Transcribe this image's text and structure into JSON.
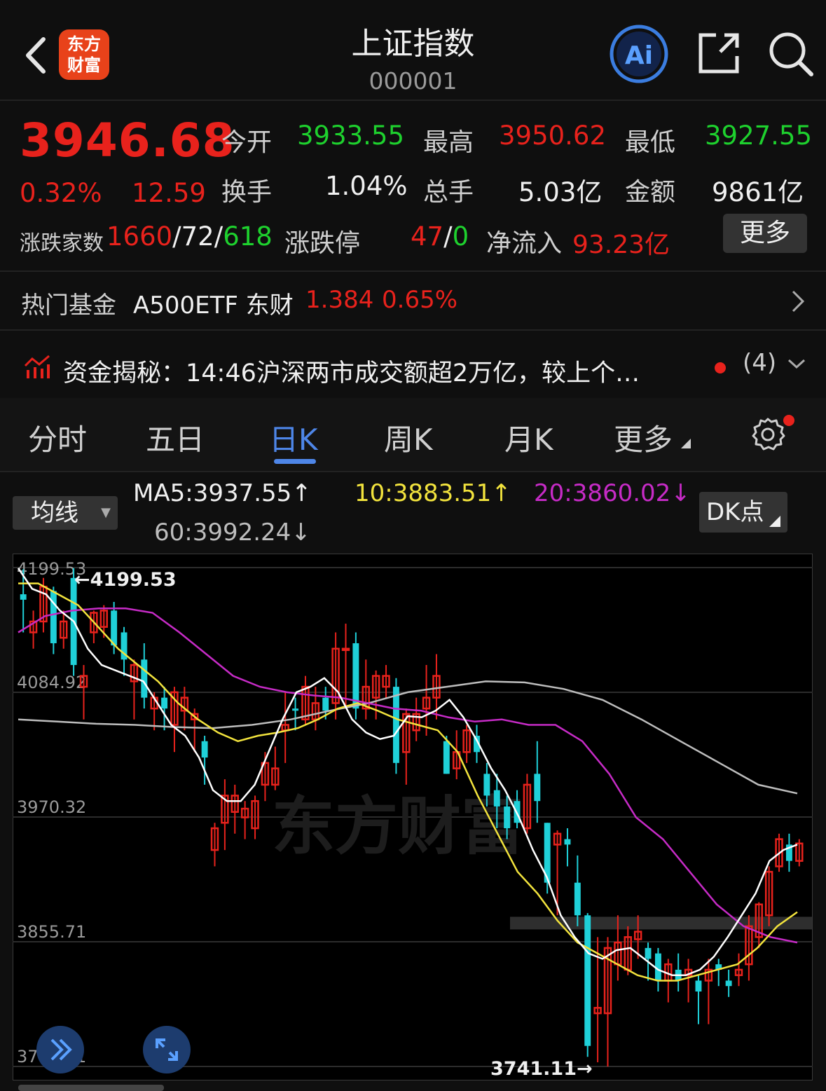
{
  "header": {
    "title": "上证指数",
    "code": "000001",
    "logo_line1": "东方",
    "logo_line2": "财富",
    "ai_label": "Ai"
  },
  "quote": {
    "price": "3946.68",
    "change_pct": "0.32%",
    "change": "12.59",
    "open_label": "今开",
    "open": "3933.55",
    "high_label": "最高",
    "high": "3950.62",
    "low_label": "最低",
    "low": "3927.55",
    "turnover_label": "换手",
    "turnover": "1.04%",
    "volume_label": "总手",
    "volume": "5.03亿",
    "amount_label": "金额",
    "amount": "9861亿",
    "breadth_label": "涨跌家数",
    "up": "1660",
    "flat": "72",
    "down": "618",
    "sep": "/",
    "limit_label": "涨跌停",
    "limit_up": "47",
    "limit_down": "0",
    "netflow_label": "净流入",
    "netflow": "93.23亿",
    "more_label": "更多"
  },
  "fund": {
    "label": "热门基金",
    "name": "A500ETF 东财",
    "price": "1.384",
    "pct": "0.65%"
  },
  "news": {
    "text": "资金揭秘：14:46沪深两市成交额超2万亿，较上个…",
    "count": "(4)"
  },
  "tabs": [
    {
      "label": "分时"
    },
    {
      "label": "五日"
    },
    {
      "label": "日K"
    },
    {
      "label": "周K"
    },
    {
      "label": "月K"
    },
    {
      "label": "更多"
    }
  ],
  "ma": {
    "selector": "均线",
    "ma5": "MA5:3937.55↑",
    "ma10": "10:3883.51↑",
    "ma20": "20:3860.02↓",
    "ma60": "60:3992.24↓",
    "dk_label": "DK点",
    "colors": {
      "ma5": "#ffffff",
      "ma10": "#f2e33d",
      "ma20": "#c62bc6",
      "ma60": "#bdbdbd"
    }
  },
  "chart_data": {
    "type": "candlestick",
    "y_ticks": [
      "4199.53",
      "4084.92",
      "3970.32",
      "3855.71",
      "3741.11"
    ],
    "ylim": [
      3741.11,
      4199.53
    ],
    "max_label": "←4199.53",
    "min_label": "3741.11→",
    "watermark": "东方财富",
    "up_color": "#e8221c",
    "down_color": "#1fd0d8",
    "candles": [
      [
        4170,
        4175,
        4140,
        4198,
        "d"
      ],
      [
        4140,
        4150,
        4125,
        4160,
        "u"
      ],
      [
        4150,
        4182,
        4140,
        4190,
        "u"
      ],
      [
        4178,
        4130,
        4120,
        4182,
        "d"
      ],
      [
        4135,
        4150,
        4125,
        4160,
        "u"
      ],
      [
        4190,
        4110,
        4100,
        4199,
        "d"
      ],
      [
        4090,
        4100,
        4060,
        4110,
        "u"
      ],
      [
        4140,
        4158,
        4130,
        4160,
        "u"
      ],
      [
        4145,
        4160,
        4135,
        4165,
        "u"
      ],
      [
        4160,
        4128,
        4120,
        4168,
        "d"
      ],
      [
        4140,
        4115,
        4100,
        4145,
        "d"
      ],
      [
        4095,
        4110,
        4060,
        4115,
        "u"
      ],
      [
        4115,
        4080,
        4070,
        4130,
        "d"
      ],
      [
        4070,
        4080,
        4050,
        4085,
        "u"
      ],
      [
        4080,
        4070,
        4050,
        4090,
        "d"
      ],
      [
        4055,
        4085,
        4030,
        4090,
        "u"
      ],
      [
        4068,
        4080,
        4050,
        4090,
        "u"
      ],
      [
        4060,
        4065,
        4030,
        4070,
        "u"
      ],
      [
        4040,
        4025,
        4000,
        4045,
        "d"
      ],
      [
        3940,
        3960,
        3925,
        3965,
        "u"
      ],
      [
        3965,
        3990,
        3940,
        4005,
        "u"
      ],
      [
        3975,
        3990,
        3955,
        4000,
        "u"
      ],
      [
        3970,
        3978,
        3950,
        3985,
        "u"
      ],
      [
        3960,
        3985,
        3950,
        3990,
        "u"
      ],
      [
        4000,
        4020,
        3985,
        4030,
        "u"
      ],
      [
        4000,
        4015,
        3995,
        4035,
        "u"
      ],
      [
        4050,
        4055,
        4020,
        4085,
        "u"
      ],
      [
        4070,
        4068,
        4050,
        4080,
        "d"
      ],
      [
        4060,
        4090,
        4055,
        4100,
        "u"
      ],
      [
        4060,
        4075,
        4050,
        4090,
        "u"
      ],
      [
        4080,
        4068,
        4060,
        4090,
        "d"
      ],
      [
        4075,
        4125,
        4060,
        4140,
        "u"
      ],
      [
        4125,
        4125,
        4070,
        4148,
        "u"
      ],
      [
        4130,
        4070,
        4060,
        4140,
        "d"
      ],
      [
        4070,
        4090,
        4060,
        4115,
        "u"
      ],
      [
        4080,
        4100,
        4060,
        4105,
        "u"
      ],
      [
        4100,
        4090,
        4080,
        4110,
        "u"
      ],
      [
        4090,
        4020,
        4010,
        4098,
        "d"
      ],
      [
        4030,
        4065,
        4000,
        4070,
        "u"
      ],
      [
        4050,
        4065,
        4040,
        4080,
        "u"
      ],
      [
        4070,
        4080,
        4045,
        4110,
        "u"
      ],
      [
        4080,
        4100,
        4060,
        4120,
        "u"
      ],
      [
        4040,
        4010,
        4010,
        4045,
        "d"
      ],
      [
        4015,
        4030,
        4005,
        4050,
        "u"
      ],
      [
        4030,
        4050,
        4020,
        4055,
        "u"
      ],
      [
        4045,
        4030,
        4020,
        4055,
        "d"
      ],
      [
        4010,
        3990,
        3980,
        4020,
        "d"
      ],
      [
        3995,
        3980,
        3960,
        4010,
        "d"
      ],
      [
        3980,
        3960,
        3950,
        3990,
        "d"
      ],
      [
        3985,
        3965,
        3960,
        3995,
        "d"
      ],
      [
        3960,
        4000,
        3955,
        4010,
        "u"
      ],
      [
        4010,
        3985,
        3965,
        4040,
        "d"
      ],
      [
        3965,
        3910,
        3900,
        3965,
        "d"
      ],
      [
        3945,
        3955,
        3880,
        3958,
        "u"
      ],
      [
        3950,
        3945,
        3925,
        3960,
        "d"
      ],
      [
        3910,
        3880,
        3870,
        3935,
        "d"
      ],
      [
        3880,
        3760,
        3750,
        3882,
        "d"
      ],
      [
        3790,
        3795,
        3745,
        3860,
        "u"
      ],
      [
        3790,
        3850,
        3741,
        3860,
        "u"
      ],
      [
        3855,
        3835,
        3820,
        3880,
        "u"
      ],
      [
        3830,
        3860,
        3825,
        3870,
        "u"
      ],
      [
        3858,
        3865,
        3840,
        3880,
        "u"
      ],
      [
        3850,
        3840,
        3820,
        3855,
        "d"
      ],
      [
        3845,
        3820,
        3810,
        3850,
        "d"
      ],
      [
        3820,
        3835,
        3800,
        3840,
        "u"
      ],
      [
        3830,
        3820,
        3810,
        3845,
        "d"
      ],
      [
        3825,
        3830,
        3800,
        3840,
        "u"
      ],
      [
        3820,
        3810,
        3780,
        3825,
        "d"
      ],
      [
        3820,
        3830,
        3780,
        3840,
        "u"
      ],
      [
        3835,
        3830,
        3815,
        3840,
        "d"
      ],
      [
        3820,
        3815,
        3805,
        3830,
        "d"
      ],
      [
        3825,
        3830,
        3815,
        3845,
        "u"
      ],
      [
        3835,
        3870,
        3820,
        3880,
        "u"
      ],
      [
        3860,
        3890,
        3850,
        3892,
        "u"
      ],
      [
        3880,
        3920,
        3870,
        3925,
        "u"
      ],
      [
        3925,
        3950,
        3920,
        3955,
        "u"
      ],
      [
        3945,
        3930,
        3920,
        3955,
        "d"
      ],
      [
        3930,
        3946,
        3925,
        3950,
        "u"
      ]
    ],
    "ma5_line": [
      4199,
      4180,
      4175,
      4160,
      4150,
      4125,
      4110,
      4105,
      4100,
      4095,
      4075,
      4055,
      4045,
      4025,
      3995,
      3985,
      3985,
      4000,
      4030,
      4060,
      4085,
      4090,
      4098,
      4085,
      4060,
      4048,
      4042,
      4045,
      4063,
      4062,
      4068,
      4078,
      4062,
      4040,
      4015,
      3995,
      3970,
      3940,
      3915,
      3880,
      3860,
      3845,
      3840,
      3848,
      3850,
      3840,
      3830,
      3825,
      3825,
      3830,
      3842,
      3860,
      3880,
      3900,
      3930,
      3940,
      3945
    ],
    "ma10_line": [
      4185,
      4185,
      4175,
      4165,
      4145,
      4125,
      4110,
      4095,
      4075,
      4060,
      4048,
      4040,
      4045,
      4048,
      4052,
      4060,
      4070,
      4075,
      4068,
      4060,
      4055,
      4050,
      4030,
      3990,
      3955,
      3920,
      3900,
      3875,
      3855,
      3845,
      3835,
      3825,
      3820,
      3820,
      3825,
      3830,
      3835,
      3850,
      3870,
      3883
    ],
    "ma20_line": [
      4140,
      4155,
      4160,
      4162,
      4162,
      4158,
      4140,
      4120,
      4100,
      4090,
      4085,
      4082,
      4080,
      4075,
      4070,
      4068,
      4062,
      4058,
      4060,
      4055,
      4055,
      4040,
      4010,
      3970,
      3950,
      3920,
      3890,
      3870,
      3860,
      3855
    ],
    "ma60_line": [
      4060,
      4058,
      4056,
      4055,
      4053,
      4052,
      4055,
      4060,
      4068,
      4075,
      4085,
      4090,
      4095,
      4094,
      4088,
      4078,
      4060,
      4040,
      4020,
      4000,
      3992
    ]
  }
}
